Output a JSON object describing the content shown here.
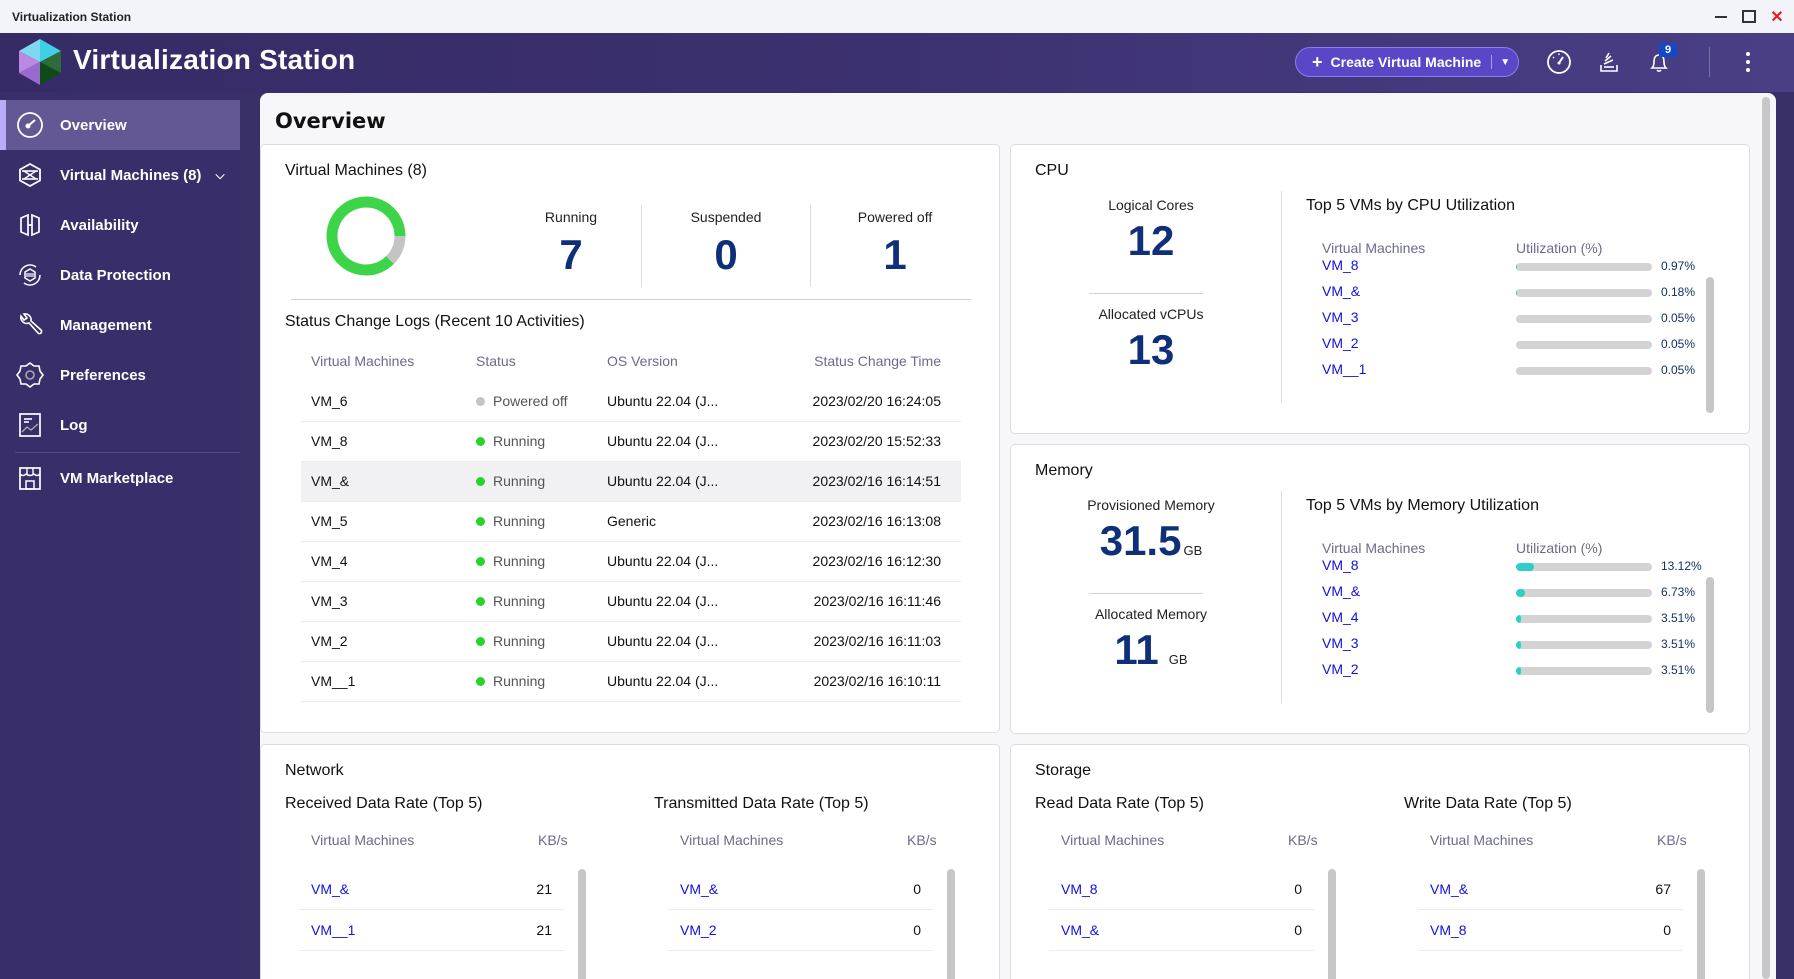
{
  "window": {
    "title": "Virtualization Station"
  },
  "header": {
    "app_title": "Virtualization Station",
    "create_button": "Create Virtual Machine",
    "notification_count": "9",
    "icons": [
      "dashboard-gauge-icon",
      "task-stack-icon",
      "bell-icon",
      "more-vertical-icon"
    ]
  },
  "sidebar": {
    "items": [
      {
        "label": "Overview",
        "icon": "gauge-icon",
        "active": true
      },
      {
        "label": "Virtual Machines (8)",
        "icon": "vm-cube-icon",
        "expandable": true
      },
      {
        "label": "Availability",
        "icon": "availability-icon"
      },
      {
        "label": "Data Protection",
        "icon": "data-protection-icon"
      },
      {
        "label": "Management",
        "icon": "wrench-icon"
      },
      {
        "label": "Preferences",
        "icon": "gear-icon"
      },
      {
        "label": "Log",
        "icon": "log-icon"
      },
      {
        "label": "VM Marketplace",
        "icon": "store-icon"
      }
    ]
  },
  "page": {
    "title": "Overview"
  },
  "vm_summary": {
    "title": "Virtual Machines (8)",
    "running_label": "Running",
    "running": "7",
    "suspended_label": "Suspended",
    "suspended": "0",
    "powered_off_label": "Powered off",
    "powered_off": "1",
    "donut": {
      "running": 7,
      "suspended": 0,
      "powered_off": 1,
      "colors": {
        "running": "#3ed44a",
        "powered_off": "#c4c4c4"
      }
    }
  },
  "status_logs": {
    "title": "Status Change Logs (Recent 10 Activities)",
    "columns": [
      "Virtual Machines",
      "Status",
      "OS Version",
      "Status Change Time"
    ],
    "rows": [
      {
        "vm": "VM_6",
        "status": "Powered off",
        "state": "gray",
        "os": "Ubuntu 22.04 (J...",
        "time": "2023/02/20 16:24:05"
      },
      {
        "vm": "VM_8",
        "status": "Running",
        "state": "green",
        "os": "Ubuntu 22.04 (J...",
        "time": "2023/02/20 15:52:33"
      },
      {
        "vm": "VM_&",
        "status": "Running",
        "state": "green",
        "os": "Ubuntu 22.04 (J...",
        "time": "2023/02/16 16:14:51"
      },
      {
        "vm": "VM_5",
        "status": "Running",
        "state": "green",
        "os": "Generic",
        "time": "2023/02/16 16:13:08"
      },
      {
        "vm": "VM_4",
        "status": "Running",
        "state": "green",
        "os": "Ubuntu 22.04 (J...",
        "time": "2023/02/16 16:12:30"
      },
      {
        "vm": "VM_3",
        "status": "Running",
        "state": "green",
        "os": "Ubuntu 22.04 (J...",
        "time": "2023/02/16 16:11:46"
      },
      {
        "vm": "VM_2",
        "status": "Running",
        "state": "green",
        "os": "Ubuntu 22.04 (J...",
        "time": "2023/02/16 16:11:03"
      },
      {
        "vm": "VM__1",
        "status": "Running",
        "state": "green",
        "os": "Ubuntu 22.04 (J...",
        "time": "2023/02/16 16:10:11"
      }
    ]
  },
  "cpu": {
    "title": "CPU",
    "logical_cores_label": "Logical Cores",
    "logical_cores": "12",
    "vcpus_label": "Allocated vCPUs",
    "vcpus": "13",
    "top_title": "Top 5 VMs by CPU Utilization",
    "col_vm": "Virtual Machines",
    "col_util": "Utilization (%)",
    "top": [
      {
        "vm": "VM_8",
        "pct": 0.97,
        "label": "0.97%"
      },
      {
        "vm": "VM_&",
        "pct": 0.18,
        "label": "0.18%"
      },
      {
        "vm": "VM_3",
        "pct": 0.05,
        "label": "0.05%"
      },
      {
        "vm": "VM_2",
        "pct": 0.05,
        "label": "0.05%"
      },
      {
        "vm": "VM__1",
        "pct": 0.05,
        "label": "0.05%"
      }
    ]
  },
  "memory": {
    "title": "Memory",
    "provisioned_label": "Provisioned Memory",
    "provisioned": "31.5",
    "provisioned_unit": "GB",
    "allocated_label": "Allocated Memory",
    "allocated": "11",
    "allocated_unit": "GB",
    "top_title": "Top 5 VMs by Memory Utilization",
    "col_vm": "Virtual Machines",
    "col_util": "Utilization (%)",
    "top": [
      {
        "vm": "VM_8",
        "pct": 13.12,
        "label": "13.12%"
      },
      {
        "vm": "VM_&",
        "pct": 6.73,
        "label": "6.73%"
      },
      {
        "vm": "VM_4",
        "pct": 3.51,
        "label": "3.51%"
      },
      {
        "vm": "VM_3",
        "pct": 3.51,
        "label": "3.51%"
      },
      {
        "vm": "VM_2",
        "pct": 3.51,
        "label": "3.51%"
      }
    ]
  },
  "network": {
    "title": "Network",
    "received": {
      "title": "Received Data Rate (Top 5)",
      "col_vm": "Virtual Machines",
      "col_unit": "KB/s",
      "rows": [
        {
          "vm": "VM_&",
          "value": "21"
        },
        {
          "vm": "VM__1",
          "value": "21"
        }
      ]
    },
    "transmitted": {
      "title": "Transmitted Data Rate (Top 5)",
      "col_vm": "Virtual Machines",
      "col_unit": "KB/s",
      "rows": [
        {
          "vm": "VM_&",
          "value": "0"
        },
        {
          "vm": "VM_2",
          "value": "0"
        }
      ]
    }
  },
  "storage": {
    "title": "Storage",
    "read": {
      "title": "Read Data Rate (Top 5)",
      "col_vm": "Virtual Machines",
      "col_unit": "KB/s",
      "rows": [
        {
          "vm": "VM_8",
          "value": "0"
        },
        {
          "vm": "VM_&",
          "value": "0"
        }
      ]
    },
    "write": {
      "title": "Write Data Rate (Top 5)",
      "col_vm": "Virtual Machines",
      "col_unit": "KB/s",
      "rows": [
        {
          "vm": "VM_&",
          "value": "67"
        },
        {
          "vm": "VM_8",
          "value": "0"
        }
      ]
    }
  }
}
